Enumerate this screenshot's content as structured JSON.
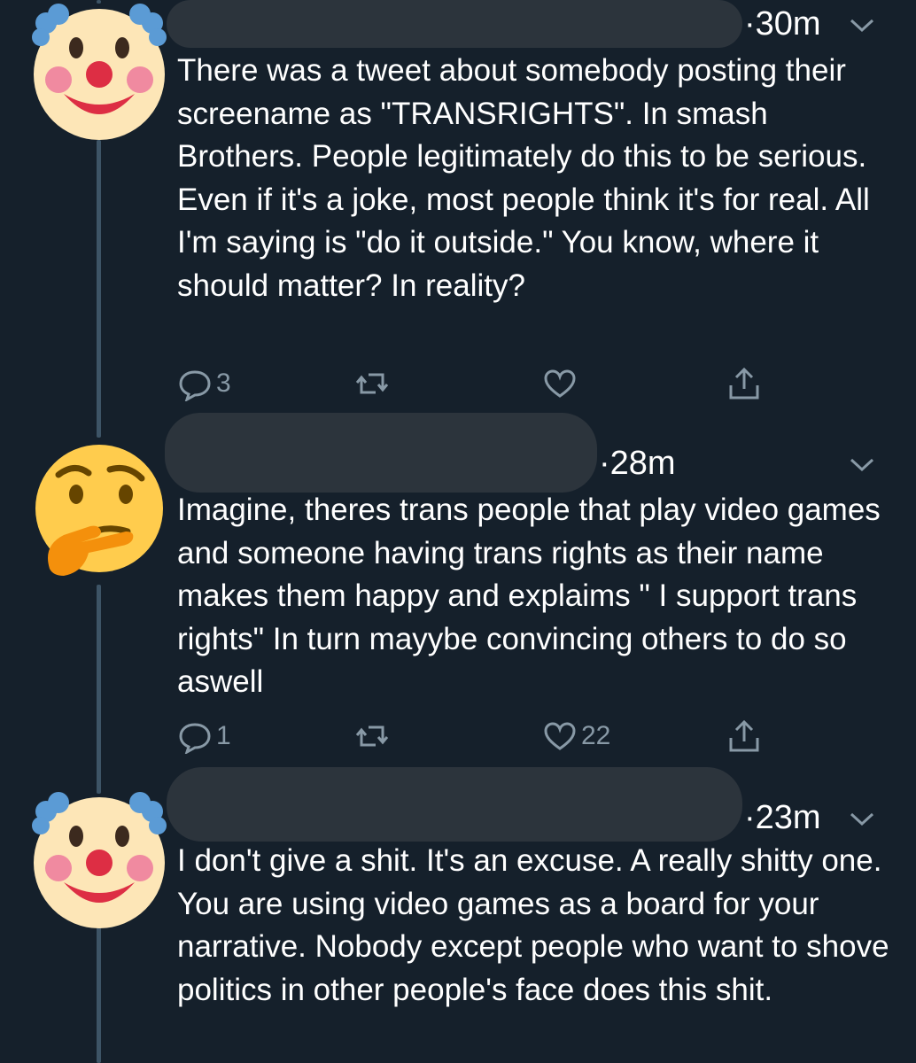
{
  "colors": {
    "background": "#15202b",
    "text": "#ffffff",
    "muted": "#8899a6",
    "thread_line": "#3d5466",
    "redaction": "#2c343c"
  },
  "tweets": [
    {
      "avatar": "clown-face-emoji",
      "timestamp": "·30m",
      "text": "There was a tweet about somebody posting their screename as \"TRANSRIGHTS\". In smash Brothers. People legitimately do this to be serious. Even if it's a joke, most people think it's for real. All I'm saying is \"do it outside.\" You know, where it should matter? In reality?",
      "reply_count": "3",
      "like_count": ""
    },
    {
      "avatar": "thinking-face-emoji",
      "timestamp": "·28m",
      "text": "Imagine, theres trans people that play video games and someone having trans rights as their name makes them happy and explaims \" I support trans rights\" In turn mayybe convincing others to do so aswell",
      "reply_count": "1",
      "like_count": "22"
    },
    {
      "avatar": "clown-face-emoji",
      "timestamp": "·23m",
      "text": "I don't give a shit. It's an excuse. A really shitty one. You are using video games as a board for your narrative. Nobody except people who want to shove politics in other people's face does this shit.",
      "reply_count": "",
      "like_count": ""
    }
  ]
}
